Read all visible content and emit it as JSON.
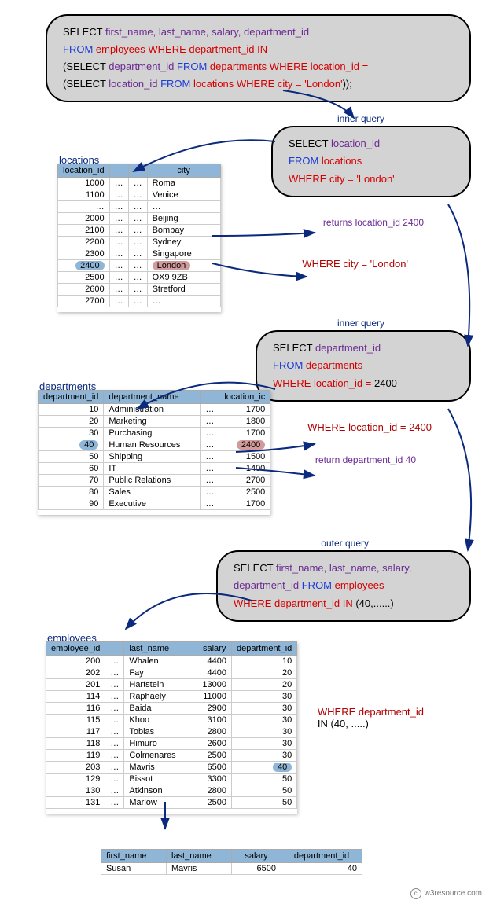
{
  "main_query": {
    "l1_select": "SELECT ",
    "l1_cols": "first_name, last_name, salary, department_id",
    "l2_from": "FROM ",
    "l2_tbl": "employees ",
    "l2_where": "WHERE ",
    "l2_cond": "department_id IN",
    "l3_open": "(",
    "l3_select": "SELECT ",
    "l3_cols": "department_id  ",
    "l3_from": "FROM ",
    "l3_tbl": "departments ",
    "l3_where": "WHERE ",
    "l3_cond": "location_id =",
    "l4_open": "(",
    "l4_select": "SELECT ",
    "l4_cols": "location_id ",
    "l4_from": "FROM ",
    "l4_tbl": "locations ",
    "l4_where": "WHERE ",
    "l4_cond": "city = 'London'",
    "l4_close": "));"
  },
  "labels": {
    "inner_query": "inner query",
    "outer_query": "outer query",
    "locations": "locations",
    "departments": "departments",
    "employees": "employees"
  },
  "box1": {
    "select": "SELECT ",
    "cols": "location_id",
    "from": "FROM ",
    "tbl": "locations",
    "where": "WHERE ",
    "cond": "city = 'London'"
  },
  "box2": {
    "select": "SELECT ",
    "cols": "department_id",
    "from": "FROM ",
    "tbl": "departments",
    "where": "WHERE ",
    "cond": "location_id = ",
    "val": "2400"
  },
  "box3": {
    "l1_select": "SELECT ",
    "l1_cols": "first_name, last_name, salary,",
    "l2_cols": "department_id ",
    "l2_from": "FROM ",
    "l2_tbl": "employees",
    "l3_where": "WHERE ",
    "l3_cond": "department_id IN ",
    "l3_val": "(40,......)"
  },
  "annot": {
    "ret_loc": "returns location_id 2400",
    "where_city": "WHERE city = 'London'",
    "where_loc": "WHERE location_id = 2400",
    "ret_dept": "return department_id 40",
    "where_dept_l1": "WHERE department_id",
    "where_dept_l2": "IN  (40, .....)"
  },
  "locations_tbl": {
    "h1": "location_id",
    "h2": "city",
    "rows": [
      {
        "id": "1000",
        "c": "Roma"
      },
      {
        "id": "1100",
        "c": "Venice"
      },
      {
        "id": "…",
        "c": "…"
      },
      {
        "id": "2000",
        "c": "Beijing"
      },
      {
        "id": "2100",
        "c": "Bombay"
      },
      {
        "id": "2200",
        "c": "Sydney"
      },
      {
        "id": "2300",
        "c": "Singapore"
      },
      {
        "id": "2400",
        "c": "London",
        "hl": true
      },
      {
        "id": "2500",
        "c": "OX9 9ZB"
      },
      {
        "id": "2600",
        "c": "Stretford"
      },
      {
        "id": "2700",
        "c": "…"
      }
    ]
  },
  "departments_tbl": {
    "h1": "department_id",
    "h2": "department_name",
    "h3": "location_ic",
    "rows": [
      {
        "id": "10",
        "n": "Administration",
        "l": "1700"
      },
      {
        "id": "20",
        "n": "Marketing",
        "l": "1800"
      },
      {
        "id": "30",
        "n": "Purchasing",
        "l": "1700"
      },
      {
        "id": "40",
        "n": "Human Resources",
        "l": "2400",
        "hl": true
      },
      {
        "id": "50",
        "n": "Shipping",
        "l": "1500"
      },
      {
        "id": "60",
        "n": "IT",
        "l": "1400"
      },
      {
        "id": "70",
        "n": "Public Relations",
        "l": "2700"
      },
      {
        "id": "80",
        "n": "Sales",
        "l": "2500"
      },
      {
        "id": "90",
        "n": "Executive",
        "l": "1700"
      }
    ]
  },
  "employees_tbl": {
    "h1": "employee_id",
    "h2": "last_name",
    "h3": "salary",
    "h4": "department_id",
    "rows": [
      {
        "e": "200",
        "ln": "Whalen",
        "s": "4400",
        "d": "10"
      },
      {
        "e": "202",
        "ln": "Fay",
        "s": "4400",
        "d": "20"
      },
      {
        "e": "201",
        "ln": "Hartstein",
        "s": "13000",
        "d": "20"
      },
      {
        "e": "114",
        "ln": "Raphaely",
        "s": "11000",
        "d": "30"
      },
      {
        "e": "116",
        "ln": "Baida",
        "s": "2900",
        "d": "30"
      },
      {
        "e": "115",
        "ln": "Khoo",
        "s": "3100",
        "d": "30"
      },
      {
        "e": "117",
        "ln": "Tobias",
        "s": "2800",
        "d": "30"
      },
      {
        "e": "118",
        "ln": "Himuro",
        "s": "2600",
        "d": "30"
      },
      {
        "e": "119",
        "ln": "Colmenares",
        "s": "2500",
        "d": "30"
      },
      {
        "e": "203",
        "ln": "Mavris",
        "s": "6500",
        "d": "40",
        "hl": true
      },
      {
        "e": "129",
        "ln": "Bissot",
        "s": "3300",
        "d": "50"
      },
      {
        "e": "130",
        "ln": "Atkinson",
        "s": "2800",
        "d": "50"
      },
      {
        "e": "131",
        "ln": "Marlow",
        "s": "2500",
        "d": "50"
      }
    ]
  },
  "result_tbl": {
    "h1": "first_name",
    "h2": "last_name",
    "h3": "salary",
    "h4": "department_id",
    "fn": "Susan",
    "ln": "Mavris",
    "s": "6500",
    "d": "40"
  },
  "credit": "w3resource.com"
}
